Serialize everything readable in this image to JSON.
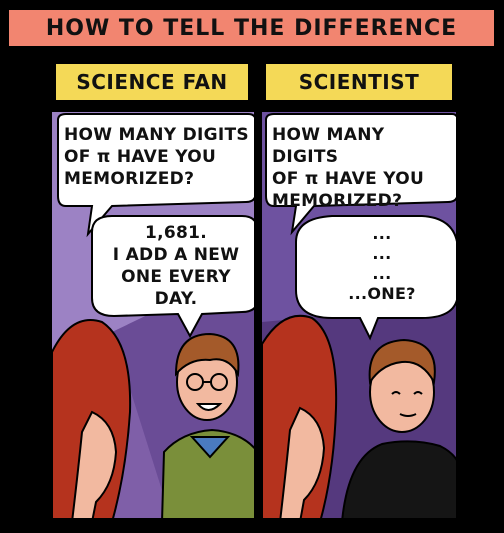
{
  "header": {
    "title": "HOW TO TELL THE DIFFERENCE"
  },
  "panels": [
    {
      "caption": "SCIENCE FAN",
      "question": "HOW MANY DIGITS\nOF π HAVE YOU\nMEMORIZED?",
      "answer": "1,681.\nI ADD A NEW\nONE EVERY\nDAY."
    },
    {
      "caption": "SCIENTIST",
      "question": "HOW MANY DIGITS\nOF π  HAVE YOU\nMEMORIZED?",
      "answer": "...\n...\n...\n...ONE?"
    }
  ],
  "colors": {
    "header_bg": "#f28570",
    "caption_bg": "#f4d957",
    "panel1_bg": "#8a6ab2",
    "panel2_bg": "#5a3e86",
    "hair": "#b5331e",
    "skin": "#f2b9a0"
  }
}
